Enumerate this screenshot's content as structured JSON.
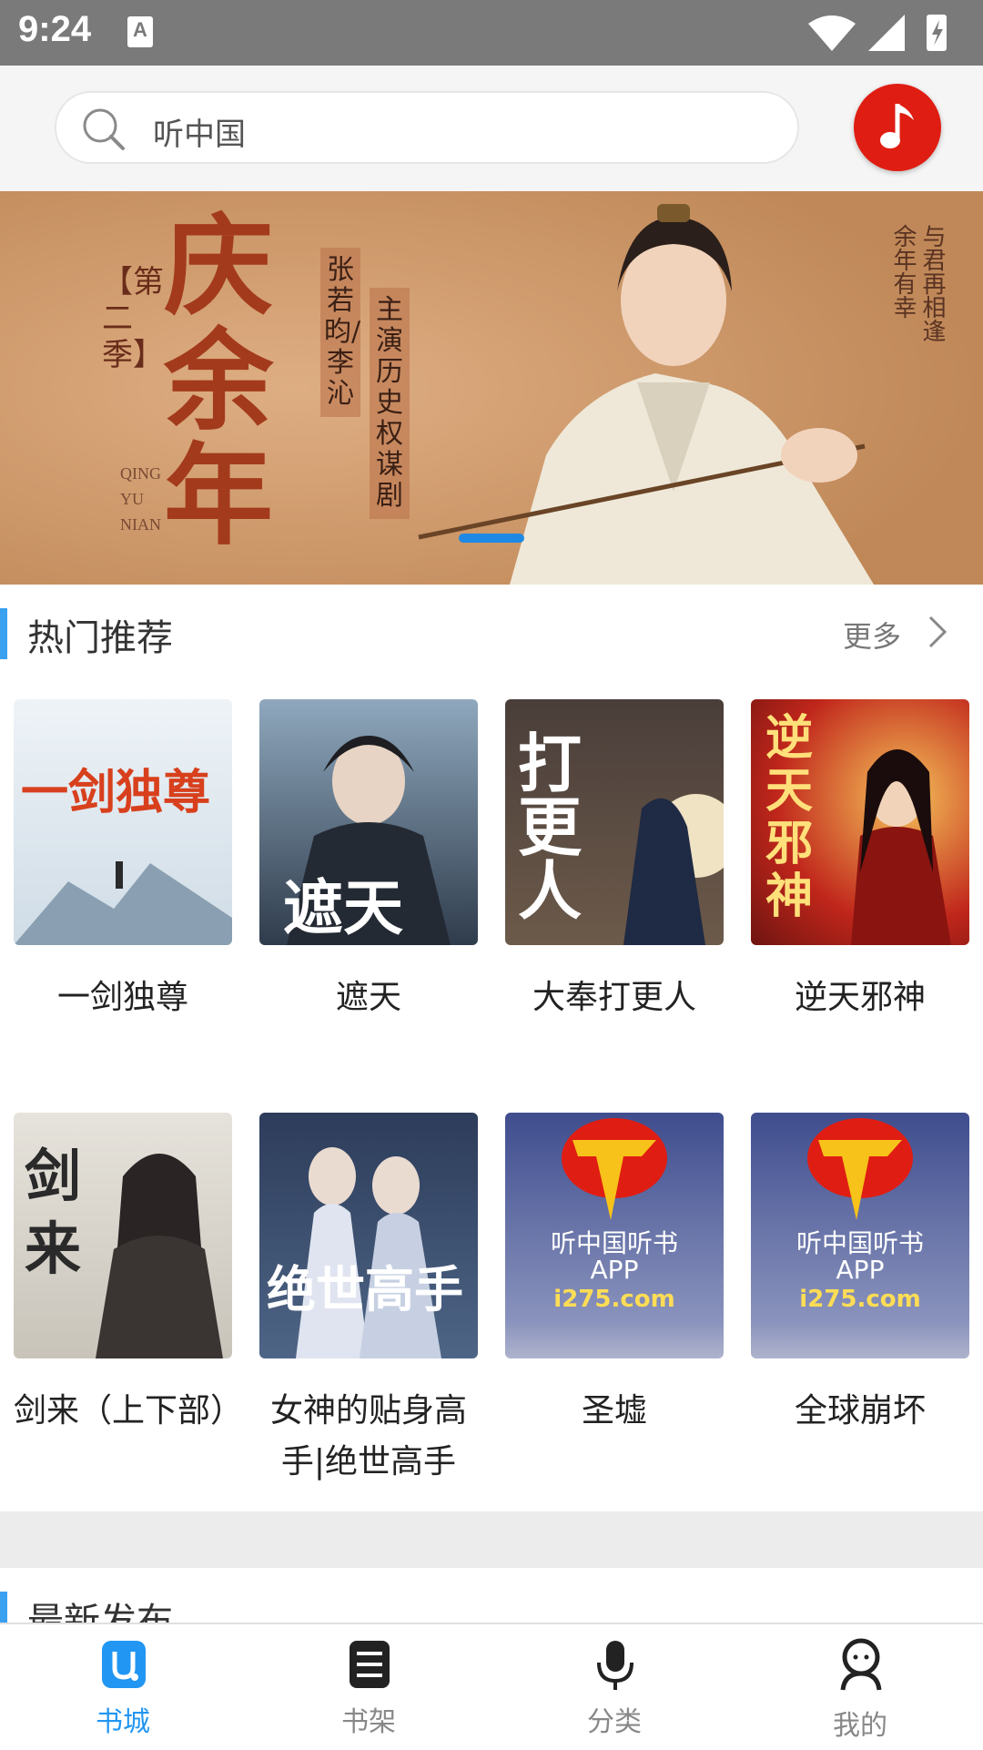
{
  "status_bar": {
    "time": "9:24",
    "notification_letter": "A"
  },
  "search": {
    "placeholder": "听中国"
  },
  "banner": {
    "season": "【第二季】",
    "title": "庆余年",
    "pinyin": "QING YU NIAN",
    "cast": "张若昀/李沁",
    "tagline": "主演历史权谋剧",
    "slogan": "与君再相逢 余年有幸"
  },
  "hot": {
    "title": "热门推荐",
    "more": "更多"
  },
  "books": [
    {
      "title": "一剑独尊",
      "cover_text": "一剑独尊",
      "cover_bg": "#dfe7ee",
      "cover_fg": "#d8401d"
    },
    {
      "title": "遮天",
      "cover_text": "遮天",
      "cover_bg": "#3d4a5a",
      "cover_fg": "#ffffff"
    },
    {
      "title": "大奉打更人",
      "cover_text": "打更人",
      "cover_bg": "#5a4a3c",
      "cover_fg": "#ffffff"
    },
    {
      "title": "逆天邪神",
      "cover_text": "逆天邪神",
      "cover_bg": "#c0261b",
      "cover_fg": "#ffe07a"
    },
    {
      "title": "剑来（上下部）",
      "cover_text": "剑来",
      "cover_bg": "#d9d6cf",
      "cover_fg": "#2a2a2a"
    },
    {
      "title": "女神的贴身高手|绝世高手",
      "cover_text": "绝世高手",
      "cover_bg": "#2b3a55",
      "cover_fg": "#ffffff"
    },
    {
      "title": "圣墟",
      "cover_text": "听中国听书",
      "cover_sub": "APP",
      "cover_url": "i275.com",
      "cover_bg": "#3f4d8e",
      "cover_fg": "#ffffff"
    },
    {
      "title": "全球崩坏",
      "cover_text": "听中国听书",
      "cover_sub": "APP",
      "cover_url": "i275.com",
      "cover_bg": "#3f4d8e",
      "cover_fg": "#ffffff"
    }
  ],
  "latest": {
    "title": "最新发布"
  },
  "tabs": [
    {
      "label": "书城",
      "icon": "bookstore-icon",
      "active": true
    },
    {
      "label": "书架",
      "icon": "bookshelf-icon",
      "active": false
    },
    {
      "label": "分类",
      "icon": "microphone-icon",
      "active": false
    },
    {
      "label": "我的",
      "icon": "profile-icon",
      "active": false
    }
  ],
  "colors": {
    "accent": "#2196f3",
    "brand_red": "#e01d12",
    "section_bar": "#3aa0f0"
  }
}
